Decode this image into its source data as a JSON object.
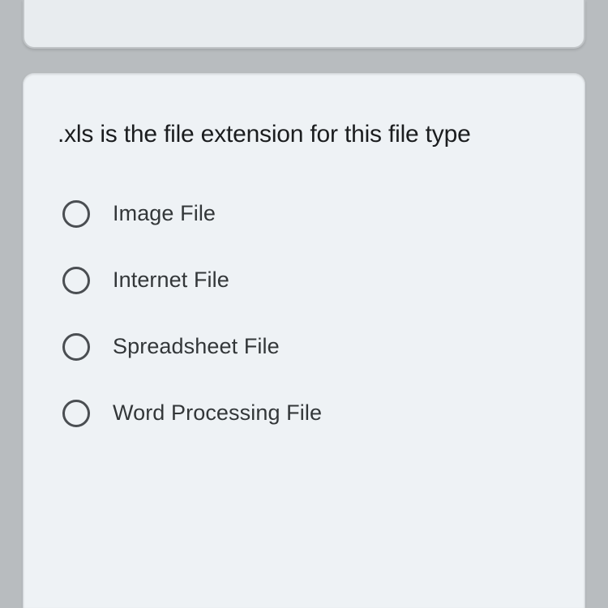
{
  "question": {
    "prompt": ".xls is the file extension for this file type",
    "options": [
      {
        "label": "Image File"
      },
      {
        "label": "Internet File"
      },
      {
        "label": "Spreadsheet File"
      },
      {
        "label": "Word Processing File"
      }
    ]
  }
}
